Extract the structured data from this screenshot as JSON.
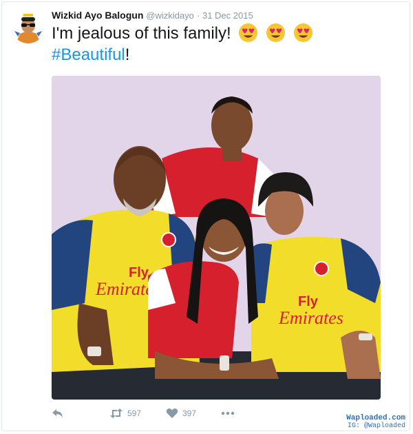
{
  "tweet": {
    "author_name": "Wizkid Ayo Balogun",
    "handle": "@wizkidayo",
    "separator": "·",
    "date": "31 Dec 2015",
    "text_main": "I'm jealous of this family!",
    "hashtag": "#Beautiful",
    "text_end": "!",
    "emojis": [
      "heart-eyes-emoji",
      "heart-eyes-emoji",
      "heart-eyes-emoji"
    ],
    "photo_kit_text": [
      "Fly",
      "Emirates"
    ]
  },
  "actions": {
    "reply_icon": "reply-icon",
    "retweet_count": "597",
    "like_count": "397",
    "more_icon": "more-icon"
  },
  "watermark": {
    "site": "Waploaded.com",
    "instagram": "IG: @Waploaded"
  },
  "colors": {
    "hashtag": "#1b95e0",
    "muted": "#8899a6",
    "photo_bg": "#e3d5e9",
    "arsenal_red": "#d6202d",
    "away_yellow": "#f2dd2b",
    "away_blue": "#23457f"
  }
}
